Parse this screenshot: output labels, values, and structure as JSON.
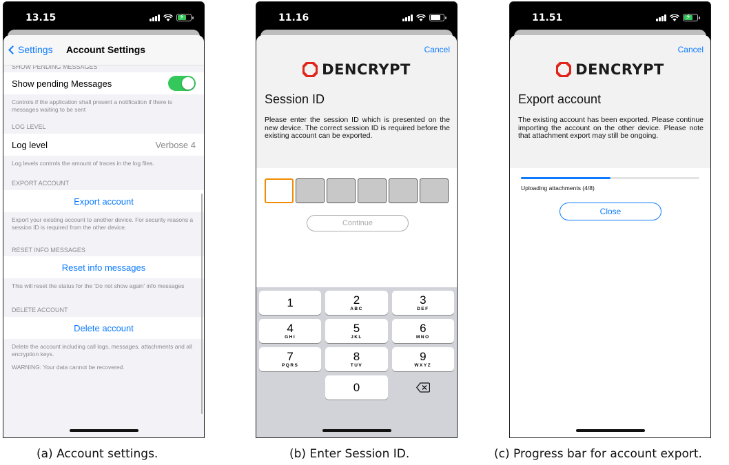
{
  "screens": {
    "a": {
      "time": "13.15",
      "back_label": "Settings",
      "title": "Account Settings",
      "sections": {
        "pending_header": "SHOW PENDING MESSAGES",
        "pending_label": "Show pending Messages",
        "pending_toggle_on": true,
        "pending_footer": "Controls if the application shall present a notification if there is messages waiting to be sent",
        "loglevel_header": "LOG LEVEL",
        "loglevel_label": "Log level",
        "loglevel_value": "Verbose 4",
        "loglevel_footer": "Log levels controls the amount of traces in the log files.",
        "export_header": "EXPORT ACCOUNT",
        "export_button": "Export account",
        "export_footer": "Export your existing account to another device. For security reasons a session ID is required from the other device.",
        "reset_header": "RESET INFO MESSAGES",
        "reset_button": "Reset info messages",
        "reset_footer": "This will reset the status for the 'Do not show again' info messages",
        "delete_header": "DELETE ACCOUNT",
        "delete_button": "Delete account",
        "delete_footer": "Delete the account including call logs, messages, attachments and all encryption keys.",
        "warning": "WARNING: Your data cannot be recovered."
      }
    },
    "b": {
      "time": "11.16",
      "cancel": "Cancel",
      "logo_text": "DENCRYPT",
      "heading": "Session ID",
      "body": "Please enter the session ID which is presented on the new device. The correct session ID is required before the existing account can be exported.",
      "continue": "Continue",
      "keys": [
        {
          "num": "1",
          "letters": ""
        },
        {
          "num": "2",
          "letters": "ABC"
        },
        {
          "num": "3",
          "letters": "DEF"
        },
        {
          "num": "4",
          "letters": "GHI"
        },
        {
          "num": "5",
          "letters": "JKL"
        },
        {
          "num": "6",
          "letters": "MNO"
        },
        {
          "num": "7",
          "letters": "PQRS"
        },
        {
          "num": "8",
          "letters": "TUV"
        },
        {
          "num": "9",
          "letters": "WXYZ"
        },
        {
          "num": "0",
          "letters": ""
        }
      ]
    },
    "c": {
      "time": "11.51",
      "cancel": "Cancel",
      "logo_text": "DENCRYPT",
      "heading": "Export account",
      "body": "The existing account has been exported. Please continue importing the account on the other device. Please note that attachment export may still be ongoing.",
      "progress_label": "Uploading attachments (4/8)",
      "progress_fraction": 0.5,
      "close": "Close"
    }
  },
  "captions": {
    "a": "(a) Account settings.",
    "b": "(b) Enter Session ID.",
    "c": "(c) Progress bar for account export."
  },
  "colors": {
    "ios_blue": "#0a7aff",
    "toggle_green": "#34c759",
    "logo_red": "#e0261b",
    "active_box_orange": "#f08c00"
  }
}
